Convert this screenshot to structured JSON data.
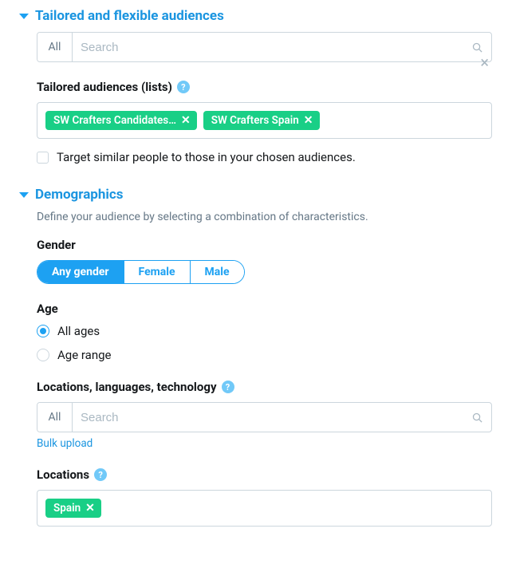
{
  "sections": {
    "tailored": {
      "title": "Tailored and flexible audiences",
      "search": {
        "all_label": "All",
        "placeholder": "Search"
      },
      "lists": {
        "title": "Tailored audiences (lists)",
        "tags": [
          "SW Crafters Candidates…",
          "SW Crafters Spain"
        ]
      },
      "similar_checkbox": "Target similar people to those in your chosen audiences."
    },
    "demographics": {
      "title": "Demographics",
      "description": "Define your audience by selecting a combination of characteristics.",
      "gender": {
        "title": "Gender",
        "options": [
          "Any gender",
          "Female",
          "Male"
        ],
        "selected": "Any gender"
      },
      "age": {
        "title": "Age",
        "options": [
          "All ages",
          "Age range"
        ],
        "selected": "All ages"
      },
      "llt": {
        "title": "Locations, languages, technology",
        "search": {
          "all_label": "All",
          "placeholder": "Search"
        },
        "bulk_link": "Bulk upload"
      },
      "locations": {
        "title": "Locations",
        "tags": [
          "Spain"
        ]
      }
    }
  }
}
